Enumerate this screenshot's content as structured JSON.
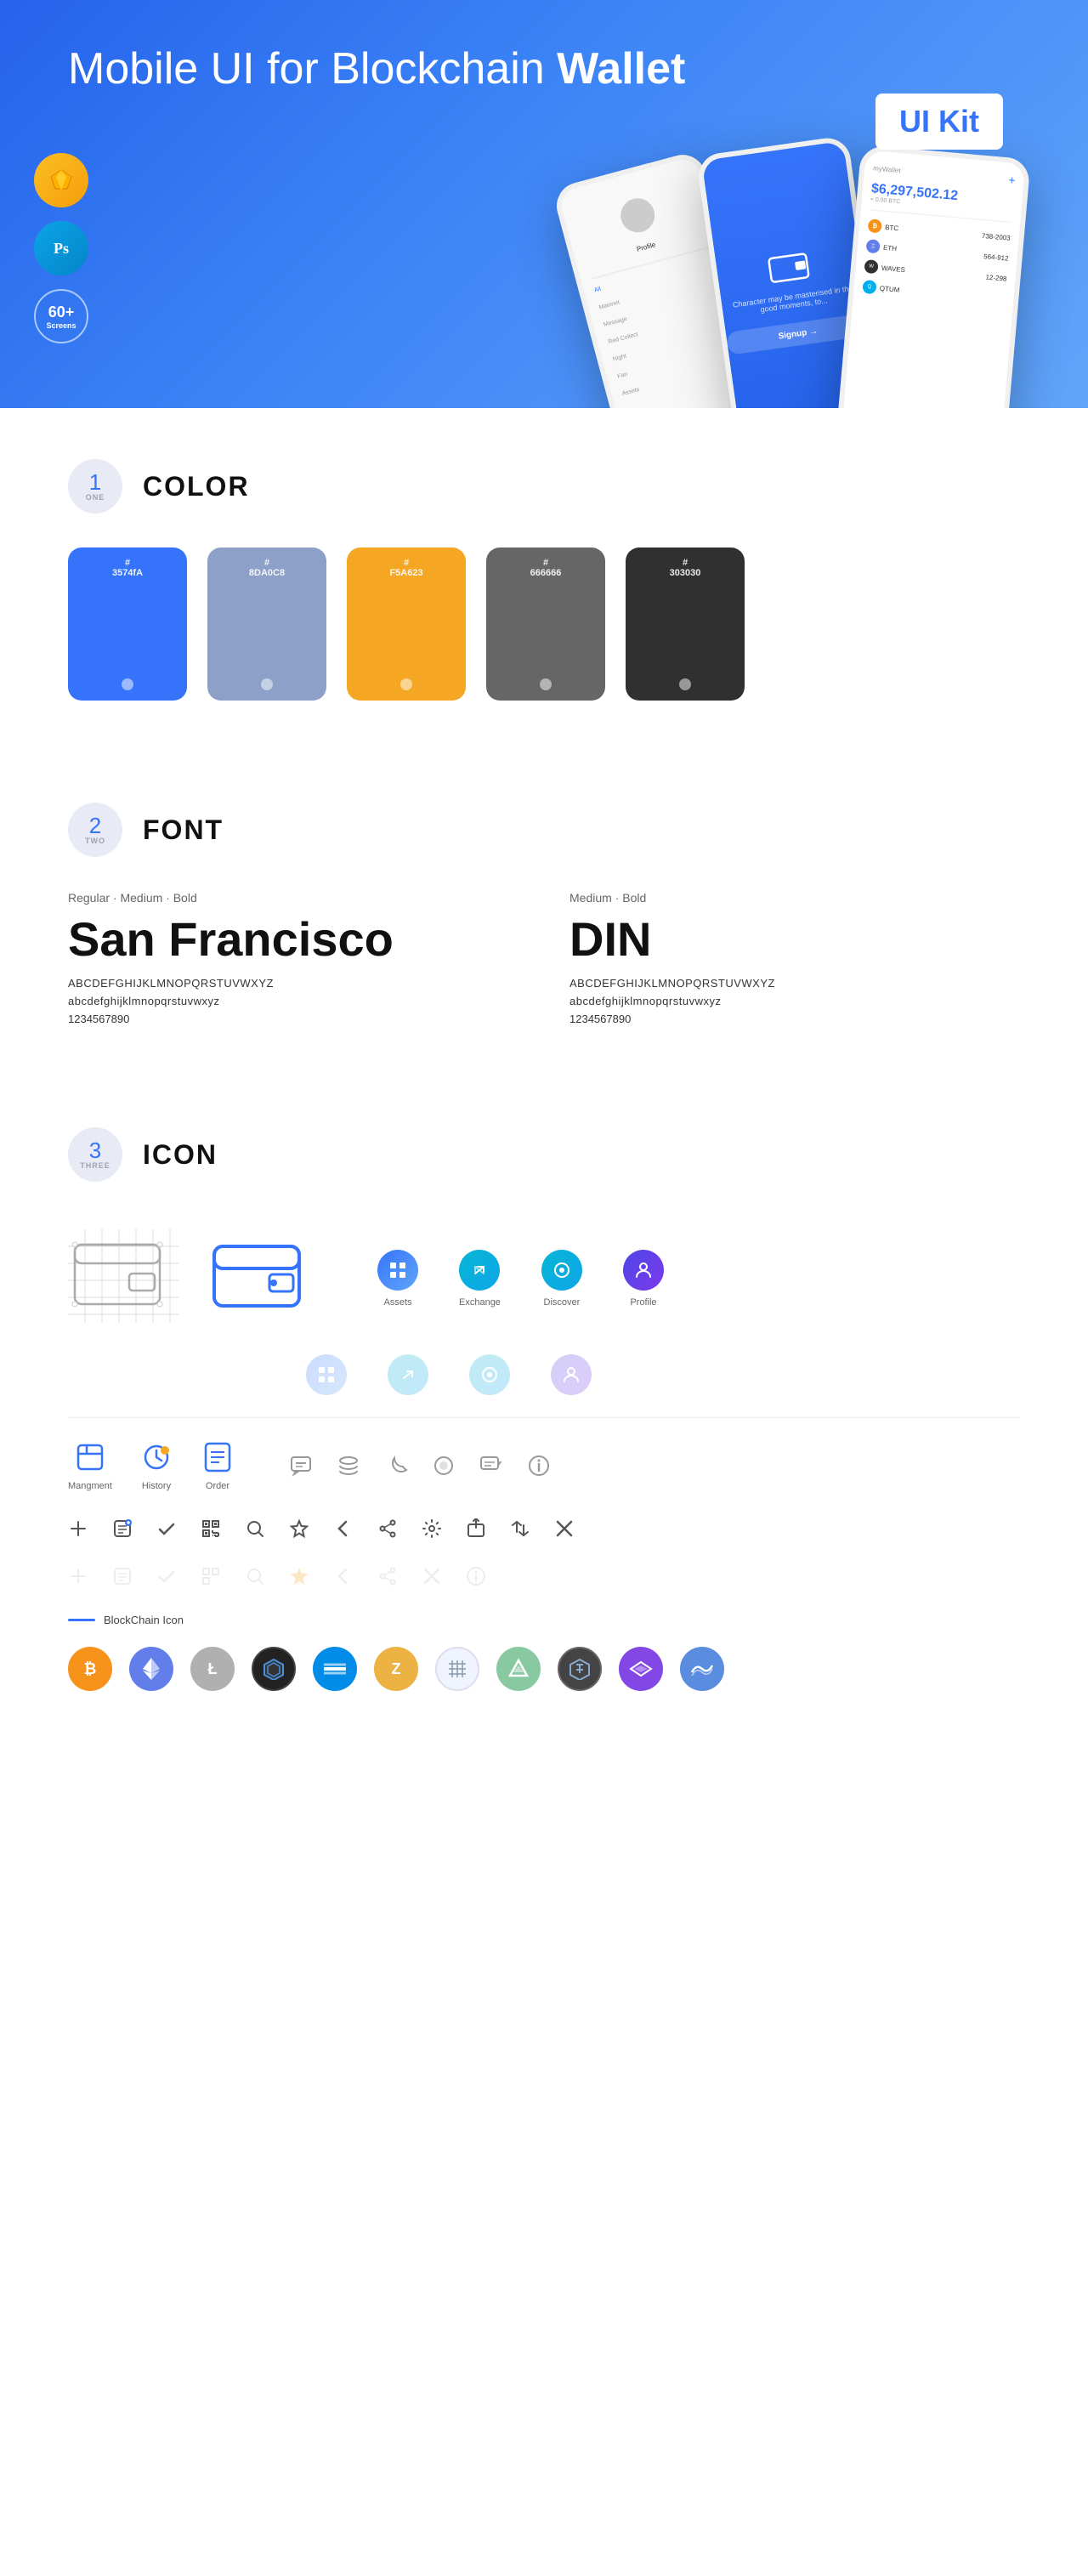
{
  "hero": {
    "title_normal": "Mobile UI for Blockchain ",
    "title_bold": "Wallet",
    "badge": "UI Kit",
    "sketch_label": "Sk",
    "ps_label": "Ps",
    "screens_num": "60+",
    "screens_label": "Screens"
  },
  "sections": {
    "color": {
      "number": "1",
      "word": "ONE",
      "title": "COLOR",
      "swatches": [
        {
          "hex": "#3574FA",
          "code": "#3574FA",
          "label": "3574fA"
        },
        {
          "hex": "#8DA0C8",
          "code": "#8DA0C8",
          "label": "8DA0C8"
        },
        {
          "hex": "#F5A623",
          "code": "#F5A623",
          "label": "F5A623"
        },
        {
          "hex": "#666666",
          "code": "#666666",
          "label": "666666"
        },
        {
          "hex": "#303030",
          "code": "#303030",
          "label": "303030"
        }
      ]
    },
    "font": {
      "number": "2",
      "word": "TWO",
      "title": "FONT",
      "font1": {
        "weights": "Regular · Medium · Bold",
        "name": "San Francisco",
        "uppercase": "ABCDEFGHIJKLMNOPQRSTUVWXYZ",
        "lowercase": "abcdefghijklmnopqrstuvwxyz",
        "numbers": "1234567890"
      },
      "font2": {
        "weights": "Medium · Bold",
        "name": "DIN",
        "uppercase": "ABCDEFGHIJKLMNOPQRSTUVWXYZ",
        "lowercase": "abcdefghijklmnopqrstuvwxyz",
        "numbers": "1234567890"
      }
    },
    "icon": {
      "number": "3",
      "word": "THREE",
      "title": "ICON",
      "nav_items": [
        {
          "label": "Assets"
        },
        {
          "label": "Exchange"
        },
        {
          "label": "Discover"
        },
        {
          "label": "Profile"
        }
      ],
      "bottom_nav": [
        {
          "label": "Mangment"
        },
        {
          "label": "History"
        },
        {
          "label": "Order"
        }
      ],
      "blockchain_label": "BlockChain Icon",
      "crypto": [
        {
          "symbol": "₿",
          "color": "#F7931A",
          "name": "Bitcoin"
        },
        {
          "symbol": "Ξ",
          "color": "#627EEA",
          "name": "Ethereum"
        },
        {
          "symbol": "Ł",
          "color": "#BFBBBB",
          "name": "Litecoin"
        },
        {
          "symbol": "◈",
          "color": "#2F3030",
          "name": "BlackCoin"
        },
        {
          "symbol": "D",
          "color": "#008CE7",
          "name": "Dash"
        },
        {
          "symbol": "Z",
          "color": "#E8E8E8",
          "name": "Zcash"
        },
        {
          "symbol": "⬡",
          "color": "#aaa",
          "name": "Enigma"
        },
        {
          "symbol": "▲",
          "color": "#88C1A3",
          "name": "Augur"
        },
        {
          "symbol": "◈",
          "color": "#444",
          "name": "Tezos"
        },
        {
          "symbol": "◆",
          "color": "#E91E63",
          "name": "Matic"
        },
        {
          "symbol": "~",
          "color": "#5577cc",
          "name": "Waves"
        }
      ]
    }
  }
}
